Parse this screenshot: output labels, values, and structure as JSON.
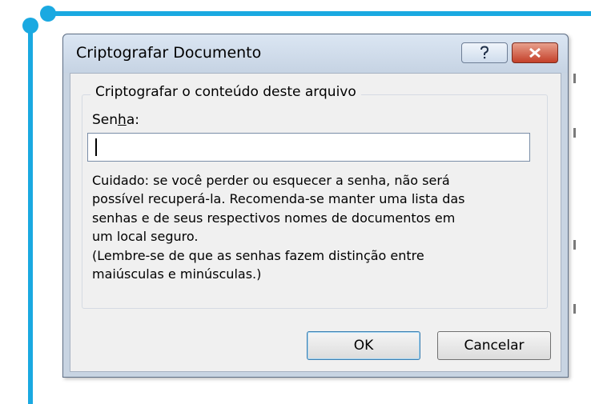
{
  "dialog": {
    "title": "Criptografar Documento",
    "help_icon": "question-mark-icon",
    "close_icon": "close-icon",
    "group_title": "Criptografar o conteúdo deste arquivo",
    "password_label_pre": "Sen",
    "password_label_accel": "h",
    "password_label_post": "a:",
    "password_value": "",
    "warning_text": "Cuidado: se você perder ou esquecer a senha, não será\npossível recuperá-la. Recomenda-se manter uma lista das\nsenhas e de seus respectivos nomes de documentos em\num local seguro.\n(Lembre-se de que as senhas fazem distinção entre\nmaiúsculas e minúsculas.)",
    "ok_label": "OK",
    "cancel_label": "Cancelar"
  },
  "colors": {
    "accent": "#1aa9e1",
    "close_button": "#c4402a",
    "titlebar": "#c6d3e3"
  }
}
